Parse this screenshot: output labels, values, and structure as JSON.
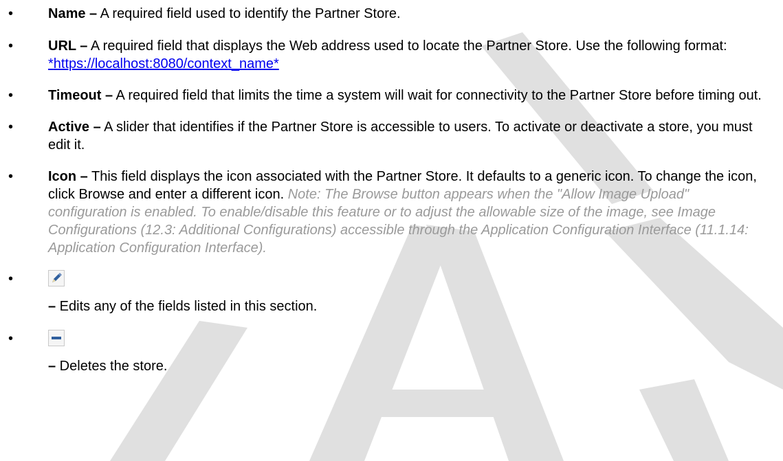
{
  "items": {
    "name": {
      "term": "Name –",
      "desc": " A required field used to identify the Partner Store."
    },
    "url": {
      "term": "URL –",
      "desc": " A required field that displays the Web address used to locate the Partner Store. Use the following format: ",
      "star_before": "*",
      "link_text": "https://localhost:8080/context_name*"
    },
    "timeout": {
      "term": "Timeout –",
      "desc": " A required field that limits the time a system will wait for connectivity to the Partner Store before timing out."
    },
    "active": {
      "term": "Active –",
      "desc": " A slider that identifies if the Partner Store is accessible to users. To activate or deactivate a store, you must edit it."
    },
    "icon": {
      "term": "Icon –",
      "desc": " This field displays the icon associated with the Partner Store. It defaults to a generic icon. To change the icon, click Browse and enter a different icon. ",
      "note": "Note: The Browse button appears when the \"Allow Image Upload\" configuration is enabled. To enable/disable this feature or to adjust the allowable size of the image, see Image Configurations (12.3: Additional Configurations) accessible through the Application Configuration Interface (11.1.14: Application Configuration Interface)."
    },
    "edit": {
      "icon": "pencil-icon",
      "dash": "–",
      "desc": " Edits any of the fields listed in this section."
    },
    "delete": {
      "icon": "minus-icon",
      "dash": "–",
      "desc": " Deletes the store."
    }
  },
  "colors": {
    "text": "#000000",
    "link": "#0000ee",
    "note": "#9a9a9a",
    "watermark": "#d9d9d9",
    "icon_blue": "#2f5f9e"
  }
}
